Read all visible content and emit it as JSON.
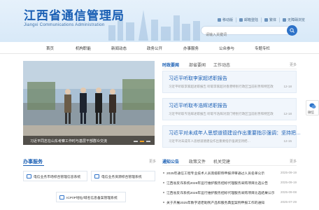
{
  "header": {
    "title": "江西省通信管理局",
    "subtitle": "Jiangxi Communications Administration",
    "links": [
      "移动版",
      "邮箱登陆",
      "繁体",
      "无障碍浏览"
    ],
    "search_placeholder": "请输入关键词"
  },
  "nav": [
    "首页",
    "机构职能",
    "新闻动态",
    "政务公开",
    "办事服务",
    "公众参与",
    "专题专栏"
  ],
  "carousel": {
    "caption": "习近平同志在山东考察工作时与基层干部群众交流"
  },
  "news": {
    "tabs": [
      "时政要闻",
      "部省要闻",
      "工作动态"
    ],
    "more": "更多",
    "items": [
      {
        "title": "习近平听取李家超述职报告",
        "desc": "习近平听取李家超述职报告 听取李家超对香港特别行政区当前形势和特区政府工作情况的汇报",
        "date": "12-18"
      },
      {
        "title": "习近平听取岑浩辉述职报告",
        "desc": "习近平听取岑浩辉述职报告 听取岑浩辉对澳门特别行政区当前形势和特区政府工作情况的汇报",
        "date": "12-18"
      },
      {
        "title": "习近平对未成年人思想道德建设作出重要指示强调：坚持把…",
        "desc": "习近平对未成年人思想道德建设作出重要指示强调坚持把…",
        "date": "12-15"
      }
    ]
  },
  "side_float": {
    "label": "微信"
  },
  "services": {
    "title": "办事服务",
    "more": "更多",
    "buttons": [
      "电信业务市场综合管理信息系统",
      "电信业务资源综合管理系统",
      "ICP/IP地址/域名信息备案管理系统"
    ]
  },
  "notices": {
    "tabs": [
      "通知公告",
      "政策文件",
      "机关党建"
    ],
    "more": "更多",
    "items": [
      {
        "title": "2025年通信工程专业技术人员高级职称申报评审通过人员名单公示",
        "date": "2025-09-19"
      },
      {
        "title": "江西省反诈系统2026年运行维护服务招标代理服务采购项目比选公告",
        "date": "2025-09-19"
      },
      {
        "title": "江西省反诈系统2026年运行维护服务招标代理服务采购项目比选结果公示",
        "date": "2025-09-08"
      },
      {
        "title": "关于开展2025年数字适老助残产品和服务典型案例申报工作的通知",
        "date": "2025-07-29"
      }
    ]
  },
  "colors": {
    "brand": "#1a5fb4",
    "accent": "#f0a020"
  }
}
